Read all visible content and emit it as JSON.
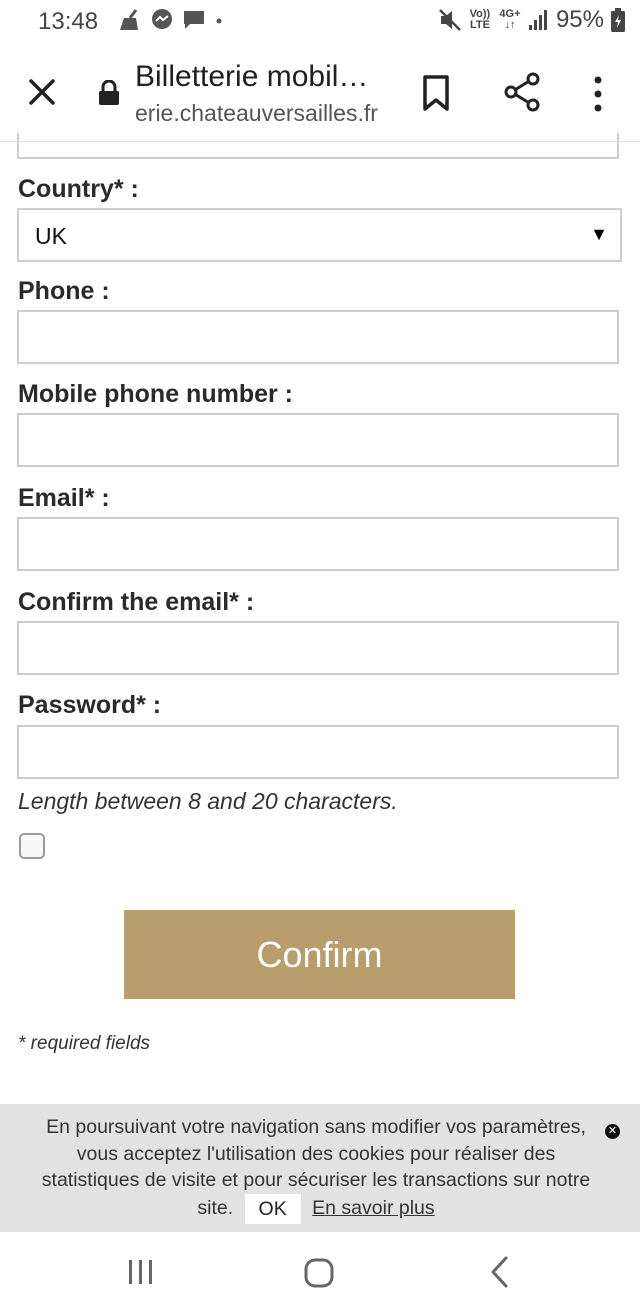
{
  "status": {
    "time": "13:48",
    "battery": "95%",
    "network_top": "Vo)) 4G+",
    "network_bottom": "LTE",
    "left_icons": [
      "clean-icon",
      "messenger-icon",
      "chat-icon",
      "dot-icon"
    ],
    "right_icons": [
      "mute-icon",
      "volte-icon",
      "lte-4g-icon",
      "signal-icon",
      "battery-icon"
    ]
  },
  "browser": {
    "title": "Billetterie mobil…",
    "url": "erie.chateauversailles.fr",
    "icons": [
      "close-icon",
      "lock-icon",
      "bookmark-icon",
      "share-icon",
      "more-vert-icon"
    ]
  },
  "form": {
    "country_label": "Country* :",
    "country_value": "UK",
    "country_arrow": "▼",
    "phone_label": "Phone :",
    "mobile_label": "Mobile phone number :",
    "email_label": "Email* :",
    "confirm_email_label": "Confirm the email* :",
    "password_label": "Password* :",
    "password_hint": "Length between 8 and 20 characters.",
    "confirm_button": "Confirm",
    "required_note": "* required fields"
  },
  "cookie": {
    "text": "En poursuivant votre navigation sans modifier vos paramètres, vous acceptez l'utilisation des cookies pour réaliser des statistiques de visite et pour sécuriser les transactions sur notre site.",
    "ok_label": "OK",
    "more_label": "En savoir plus",
    "close_glyph": "✕"
  },
  "colors": {
    "confirm_button_bg": "#b89d6d",
    "cookie_bg": "#e2e2e2",
    "input_border": "#cfcfcf"
  }
}
